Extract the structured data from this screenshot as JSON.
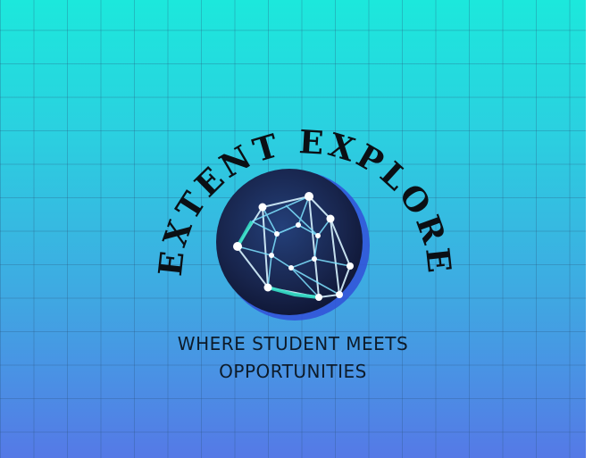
{
  "logo": {
    "brand_name": "EXTENT EXPLORE",
    "tagline_line1": "WHERE STUDENT MEETS",
    "tagline_line2": "OPPORTUNITIES",
    "emblem_icon": "polyhedron-network-icon"
  },
  "colors": {
    "background_top": "#1ce8dc",
    "background_bottom": "#5579e6",
    "emblem_fill": "#1b2a55",
    "emblem_glow": "#2d48c8",
    "text": "#0d1b2a"
  }
}
